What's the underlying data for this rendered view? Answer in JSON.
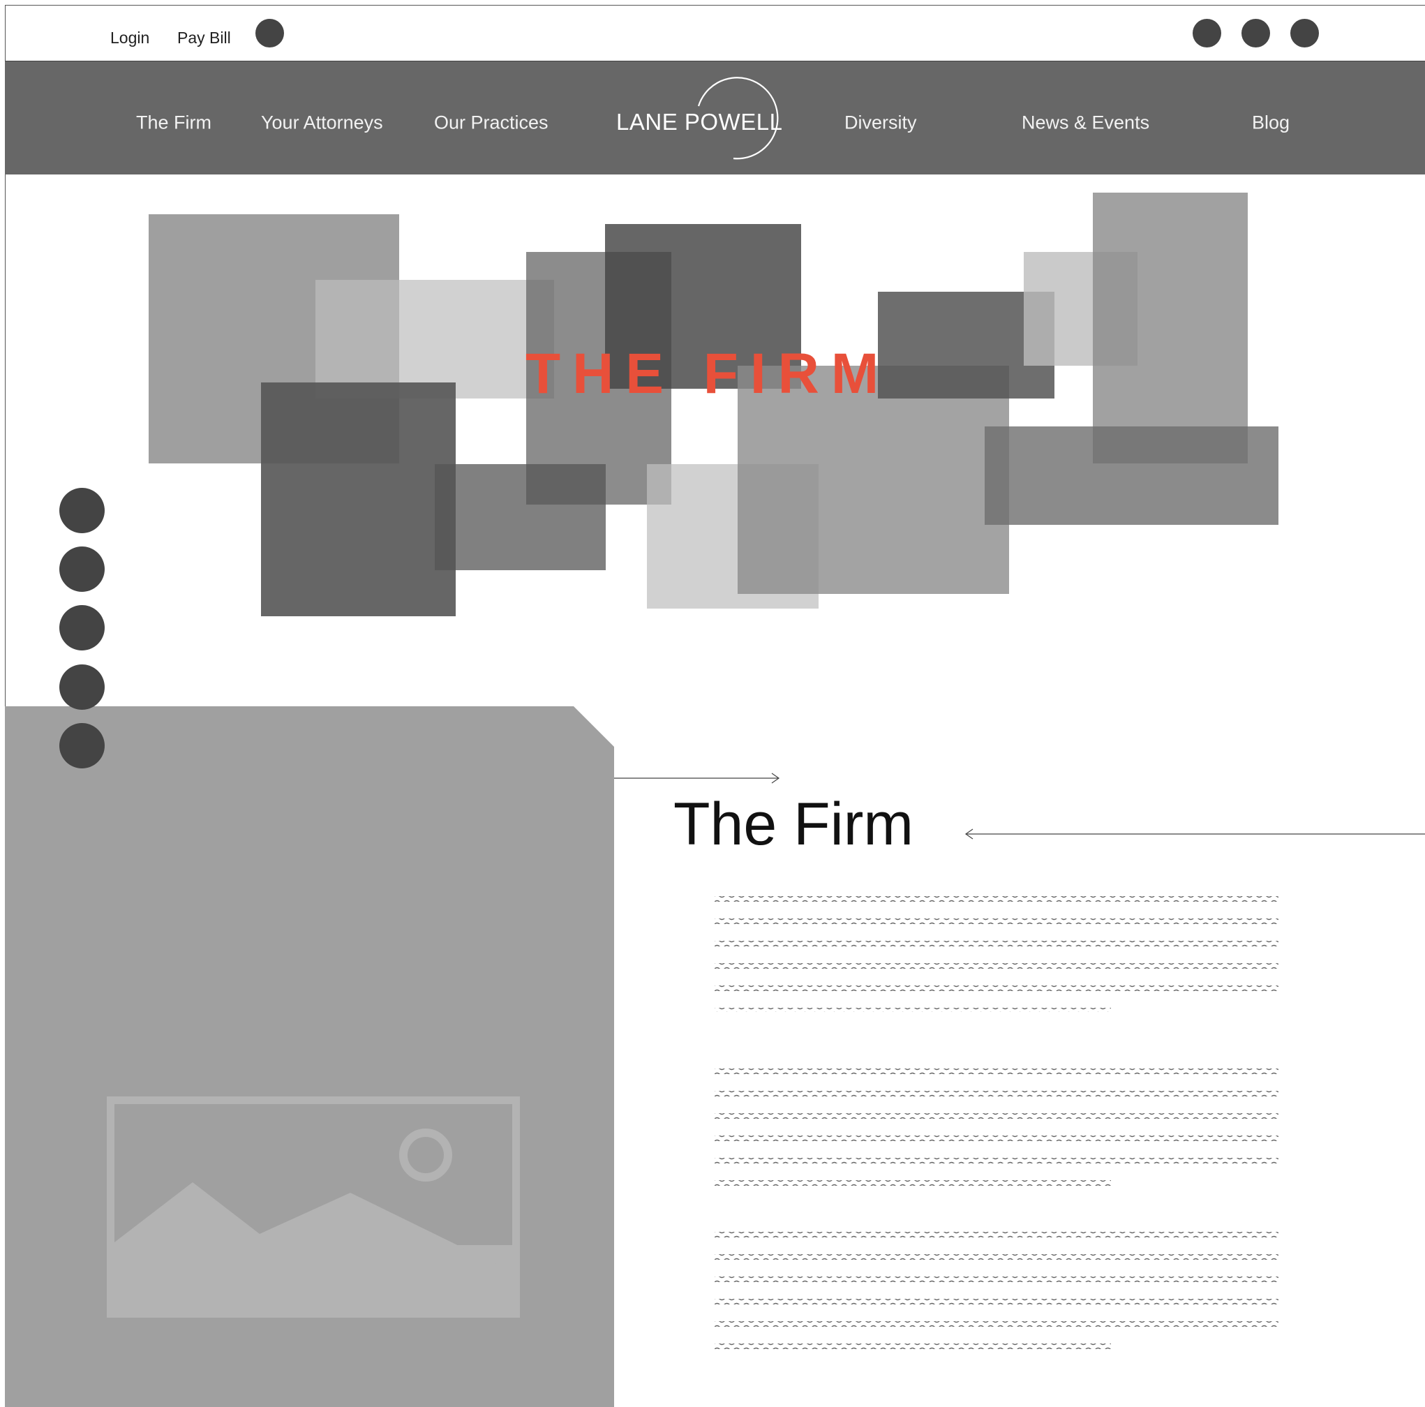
{
  "utility": {
    "login": "Login",
    "pay_bill": "Pay Bill",
    "search_icon": "circle-placeholder-icon",
    "social_icons": [
      "social-icon-1",
      "social-icon-2",
      "social-icon-3"
    ]
  },
  "nav": {
    "items": [
      {
        "label": "The Firm"
      },
      {
        "label": "Your Attorneys"
      },
      {
        "label": "Our Practices"
      },
      {
        "label": "Diversity"
      },
      {
        "label": "News & Events"
      },
      {
        "label": "Blog"
      }
    ],
    "logo": "LANE POWELL"
  },
  "hero": {
    "title": "THE FIRM"
  },
  "side_nav": {
    "dot_count": 5
  },
  "content": {
    "heading": "The Firm",
    "paragraph_count": 3,
    "image_placeholder": "image-placeholder-icon"
  },
  "colors": {
    "nav_bg": "#676767",
    "accent": "#e8503a",
    "dot": "#444444",
    "panel": "#a0a0a0"
  }
}
